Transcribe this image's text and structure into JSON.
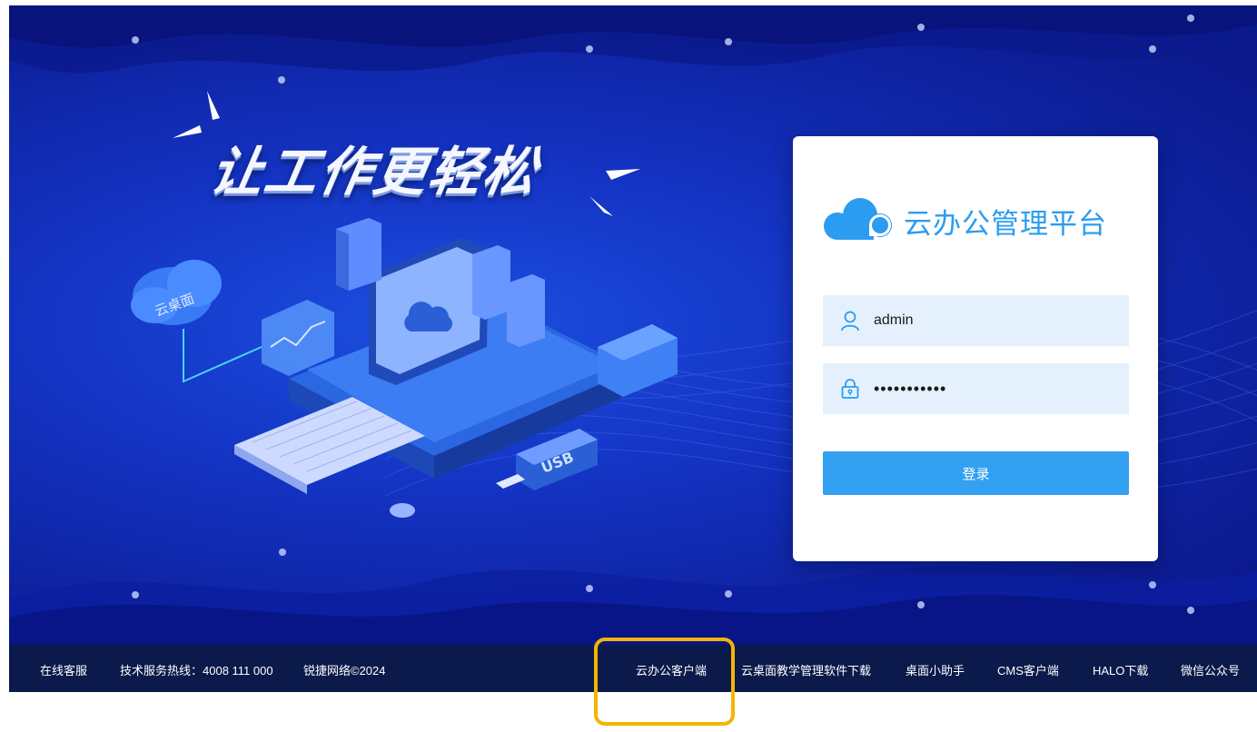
{
  "hero": {
    "slogan": "让工作更轻松",
    "cloud_badge": "云桌面",
    "usb_label": "USB"
  },
  "login": {
    "brand_name": "云办公管理平台",
    "username_value": "admin",
    "password_value": "•••••••••••",
    "submit_label": "登录"
  },
  "footer": {
    "online_service": "在线客服",
    "hotline": "技术服务热线：4008 111 000",
    "copyright": "锐捷网络©2024",
    "links": [
      "云办公客户端",
      "云桌面教学管理软件下载",
      "桌面小助手",
      "CMS客户端",
      "HALO下载",
      "微信公众号"
    ]
  },
  "colors": {
    "background_blue": "#1434c4",
    "brand_blue": "#2b9cf0",
    "button_blue": "#33a0f2",
    "input_bg": "#e4f1fc",
    "footer_bg": "#0b1a4a",
    "highlight_outline": "#f5b400"
  },
  "icons": [
    "cloud-logo-icon",
    "user-icon",
    "lock-icon"
  ]
}
